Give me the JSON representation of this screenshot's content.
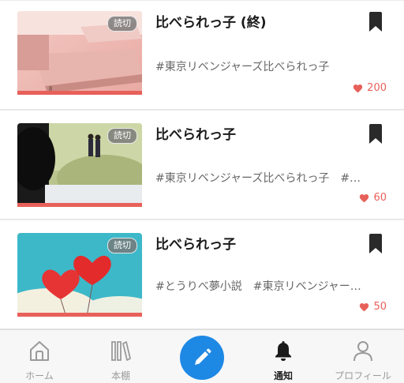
{
  "colors": {
    "accent_red": "#e8605a",
    "primary_blue": "#1e88e5",
    "tab_inactive": "#9a9a9a",
    "tab_active": "#222222"
  },
  "stories": [
    {
      "title": "比べられっ子 (終)",
      "badge": "読切",
      "tags": "#東京リベンジャーズ比べられっ子",
      "likes": "200",
      "thumbnail": "classroom-desks",
      "bookmark_icon": "bookmark-icon"
    },
    {
      "title": "比べられっ子",
      "badge": "読切",
      "tags": "#東京リベンジャーズ比べられっ子　#…",
      "likes": "60",
      "thumbnail": "couple-walking-field",
      "bookmark_icon": "bookmark-icon"
    },
    {
      "title": "比べられっ子",
      "badge": "読切",
      "tags": "#とうりべ夢小説　#東京リベンジャー…",
      "likes": "50",
      "thumbnail": "red-heart-balloons",
      "bookmark_icon": "bookmark-icon"
    }
  ],
  "tabbar": {
    "home": {
      "label": "ホーム",
      "icon": "home-icon"
    },
    "shelf": {
      "label": "本棚",
      "icon": "bookshelf-icon"
    },
    "write": {
      "icon": "pencil-icon"
    },
    "notifications": {
      "label": "通知",
      "icon": "bell-icon",
      "active": true
    },
    "profile": {
      "label": "プロフィール",
      "icon": "user-icon"
    }
  }
}
